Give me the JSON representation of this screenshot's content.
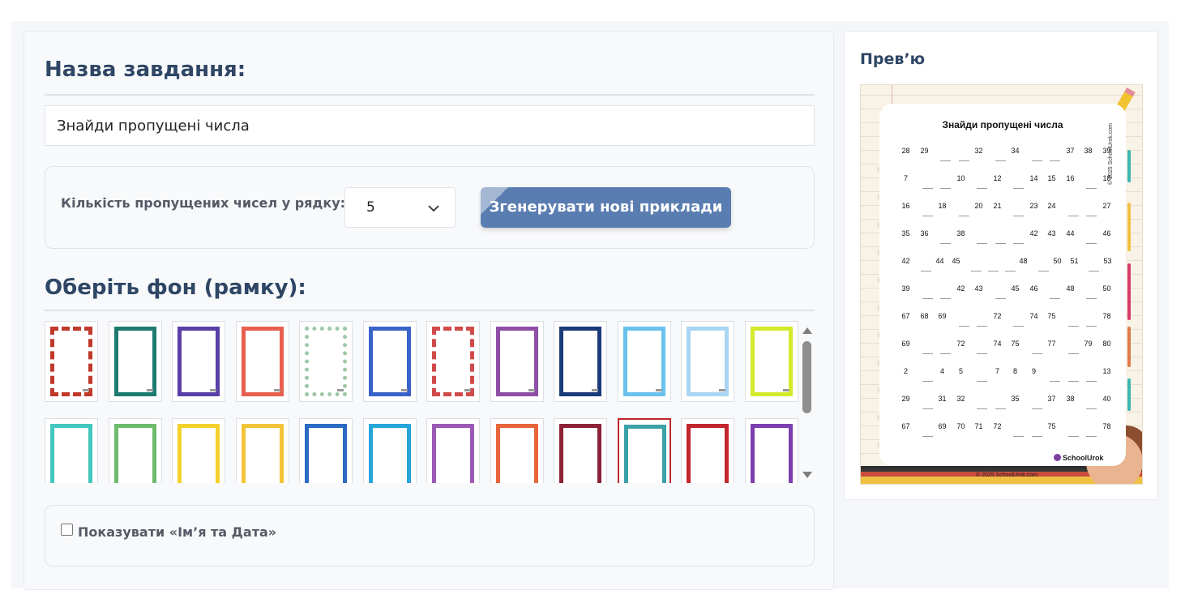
{
  "task": {
    "heading": "Назва завдання:",
    "title_value": "Знайди пропущені числа"
  },
  "settings": {
    "missing_label": "Кількість пропущених чисел у рядку:",
    "missing_value": "5",
    "generate_label": "Згенерувати нові приклади"
  },
  "frames": {
    "heading": "Оберіть фон (рамку):",
    "selected_index": 21,
    "colors": [
      "#c0392b",
      "#1e7b6f",
      "#5b3fa8",
      "#e7604f",
      "#9fc7a9",
      "#3a63c9",
      "#d04a4a",
      "#8f4ea6",
      "#1a3a78",
      "#68c2ec",
      "#a9d6f3",
      "#d3ea2c",
      "#44c7bd",
      "#6dbb6b",
      "#f2d12b",
      "#f3c43a",
      "#2a6bc3",
      "#27a5d9",
      "#9b59b6",
      "#e8653c",
      "#8d2137",
      "#3aa1a6",
      "#c0262c",
      "#7b3fb0"
    ]
  },
  "options": {
    "show_name_date_label": "Показувати «Ім’я та Дата»",
    "show_name_date_checked": false
  },
  "preview": {
    "heading": "Прев’ю",
    "worksheet_title": "Знайди пропущені числа",
    "logo": "SchoolUrok",
    "copyright_bottom": "© 2025 SchoolUrok.com",
    "copyright_side": "© 2025 SchoolUrok.com",
    "rows": [
      [
        "28",
        "29",
        "",
        "",
        "32",
        "",
        "34",
        "",
        "",
        "37",
        "38",
        "39"
      ],
      [
        "7",
        "",
        "",
        "10",
        "",
        "12",
        "",
        "14",
        "15",
        "16",
        "",
        "18"
      ],
      [
        "16",
        "",
        "18",
        "",
        "20",
        "21",
        "",
        "23",
        "24",
        "",
        "",
        "27"
      ],
      [
        "35",
        "36",
        "",
        "38",
        "",
        "",
        "",
        "42",
        "43",
        "44",
        "",
        "46"
      ],
      [
        "42",
        "",
        "44",
        "45",
        "",
        "",
        "",
        "48",
        "",
        "50",
        "51",
        "",
        "53"
      ],
      [
        "39",
        "",
        "",
        "42",
        "43",
        "",
        "45",
        "46",
        "",
        "48",
        "",
        "50"
      ],
      [
        "67",
        "68",
        "69",
        "",
        "",
        "72",
        "",
        "74",
        "75",
        "",
        "",
        "78"
      ],
      [
        "69",
        "",
        "",
        "72",
        "",
        "74",
        "75",
        "",
        "77",
        "",
        "79",
        "80"
      ],
      [
        "2",
        "",
        "4",
        "5",
        "",
        "7",
        "8",
        "9",
        "",
        "",
        "",
        "13"
      ],
      [
        "29",
        "",
        "31",
        "32",
        "",
        "",
        "35",
        "",
        "37",
        "38",
        "",
        "40"
      ],
      [
        "67",
        "",
        "69",
        "70",
        "71",
        "72",
        "",
        "",
        "75",
        "",
        "",
        "78"
      ]
    ]
  }
}
